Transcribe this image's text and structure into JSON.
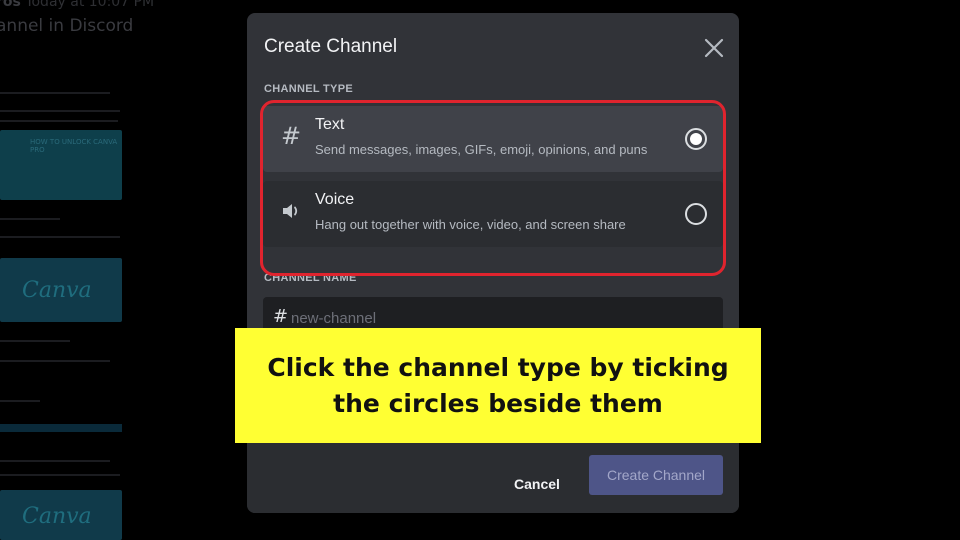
{
  "background": {
    "header_user": "ros",
    "header_time": "Today at 10:07 PM",
    "title": "annel in Discord",
    "thumb_caption": "HOW TO UNLOCK CANVA PRO",
    "thumb_logo": "Canva"
  },
  "modal": {
    "title": "Create Channel",
    "close_icon": "close-icon",
    "channel_type_label": "CHANNEL TYPE",
    "options": [
      {
        "icon": "hash-icon",
        "glyph": "#",
        "name": "Text",
        "description": "Send messages, images, GIFs, emoji, opinions, and puns",
        "selected": true
      },
      {
        "icon": "speaker-icon",
        "glyph": "🔊",
        "name": "Voice",
        "description": "Hang out together with voice, video, and screen share",
        "selected": false
      }
    ],
    "channel_name_label": "CHANNEL NAME",
    "channel_name_prefix": "#",
    "channel_name_placeholder": "new-channel",
    "cancel_label": "Cancel",
    "create_label": "Create Channel"
  },
  "callout": {
    "text": "Click the channel type by ticking the circles beside them"
  },
  "colors": {
    "modal_bg": "#313338",
    "option_selected_bg": "#404249",
    "highlight_border": "#e0242e",
    "callout_bg": "#ffff33",
    "create_button_bg": "#4e5588"
  }
}
